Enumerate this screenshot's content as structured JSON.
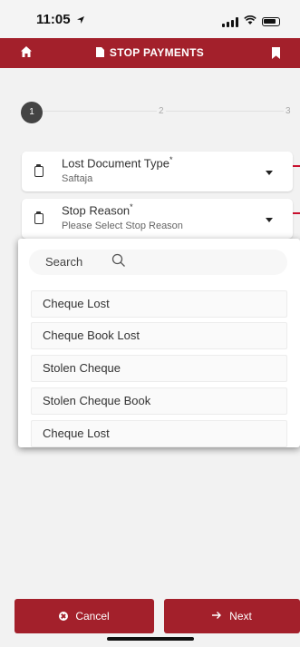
{
  "status_bar": {
    "time": "11:05"
  },
  "header": {
    "title": "STOP PAYMENTS"
  },
  "stepper": {
    "current": "1",
    "steps": [
      "2",
      "3"
    ]
  },
  "fields": [
    {
      "label": "Lost Document Type",
      "required_mark": "*",
      "value": "Saftaja"
    },
    {
      "label": "Stop Reason",
      "required_mark": "*",
      "value": "Please Select Stop Reason"
    }
  ],
  "dropdown": {
    "search_placeholder": "Search",
    "options": [
      "Cheque Lost",
      "Cheque Book Lost",
      "Stolen Cheque",
      "Stolen Cheque Book",
      "Cheque Lost"
    ]
  },
  "footer": {
    "cancel_label": "Cancel",
    "next_label": "Next"
  },
  "colors": {
    "brand": "#a3202b",
    "background": "#f2f2f2",
    "error_mark": "#c8102e"
  },
  "icons": {
    "header_left": "home-icon",
    "header_title": "document-icon",
    "header_right": "bookmark-icon",
    "field": "clipboard-icon",
    "search": "search-icon",
    "cancel": "x-circle-icon",
    "next": "arrow-right-icon"
  }
}
